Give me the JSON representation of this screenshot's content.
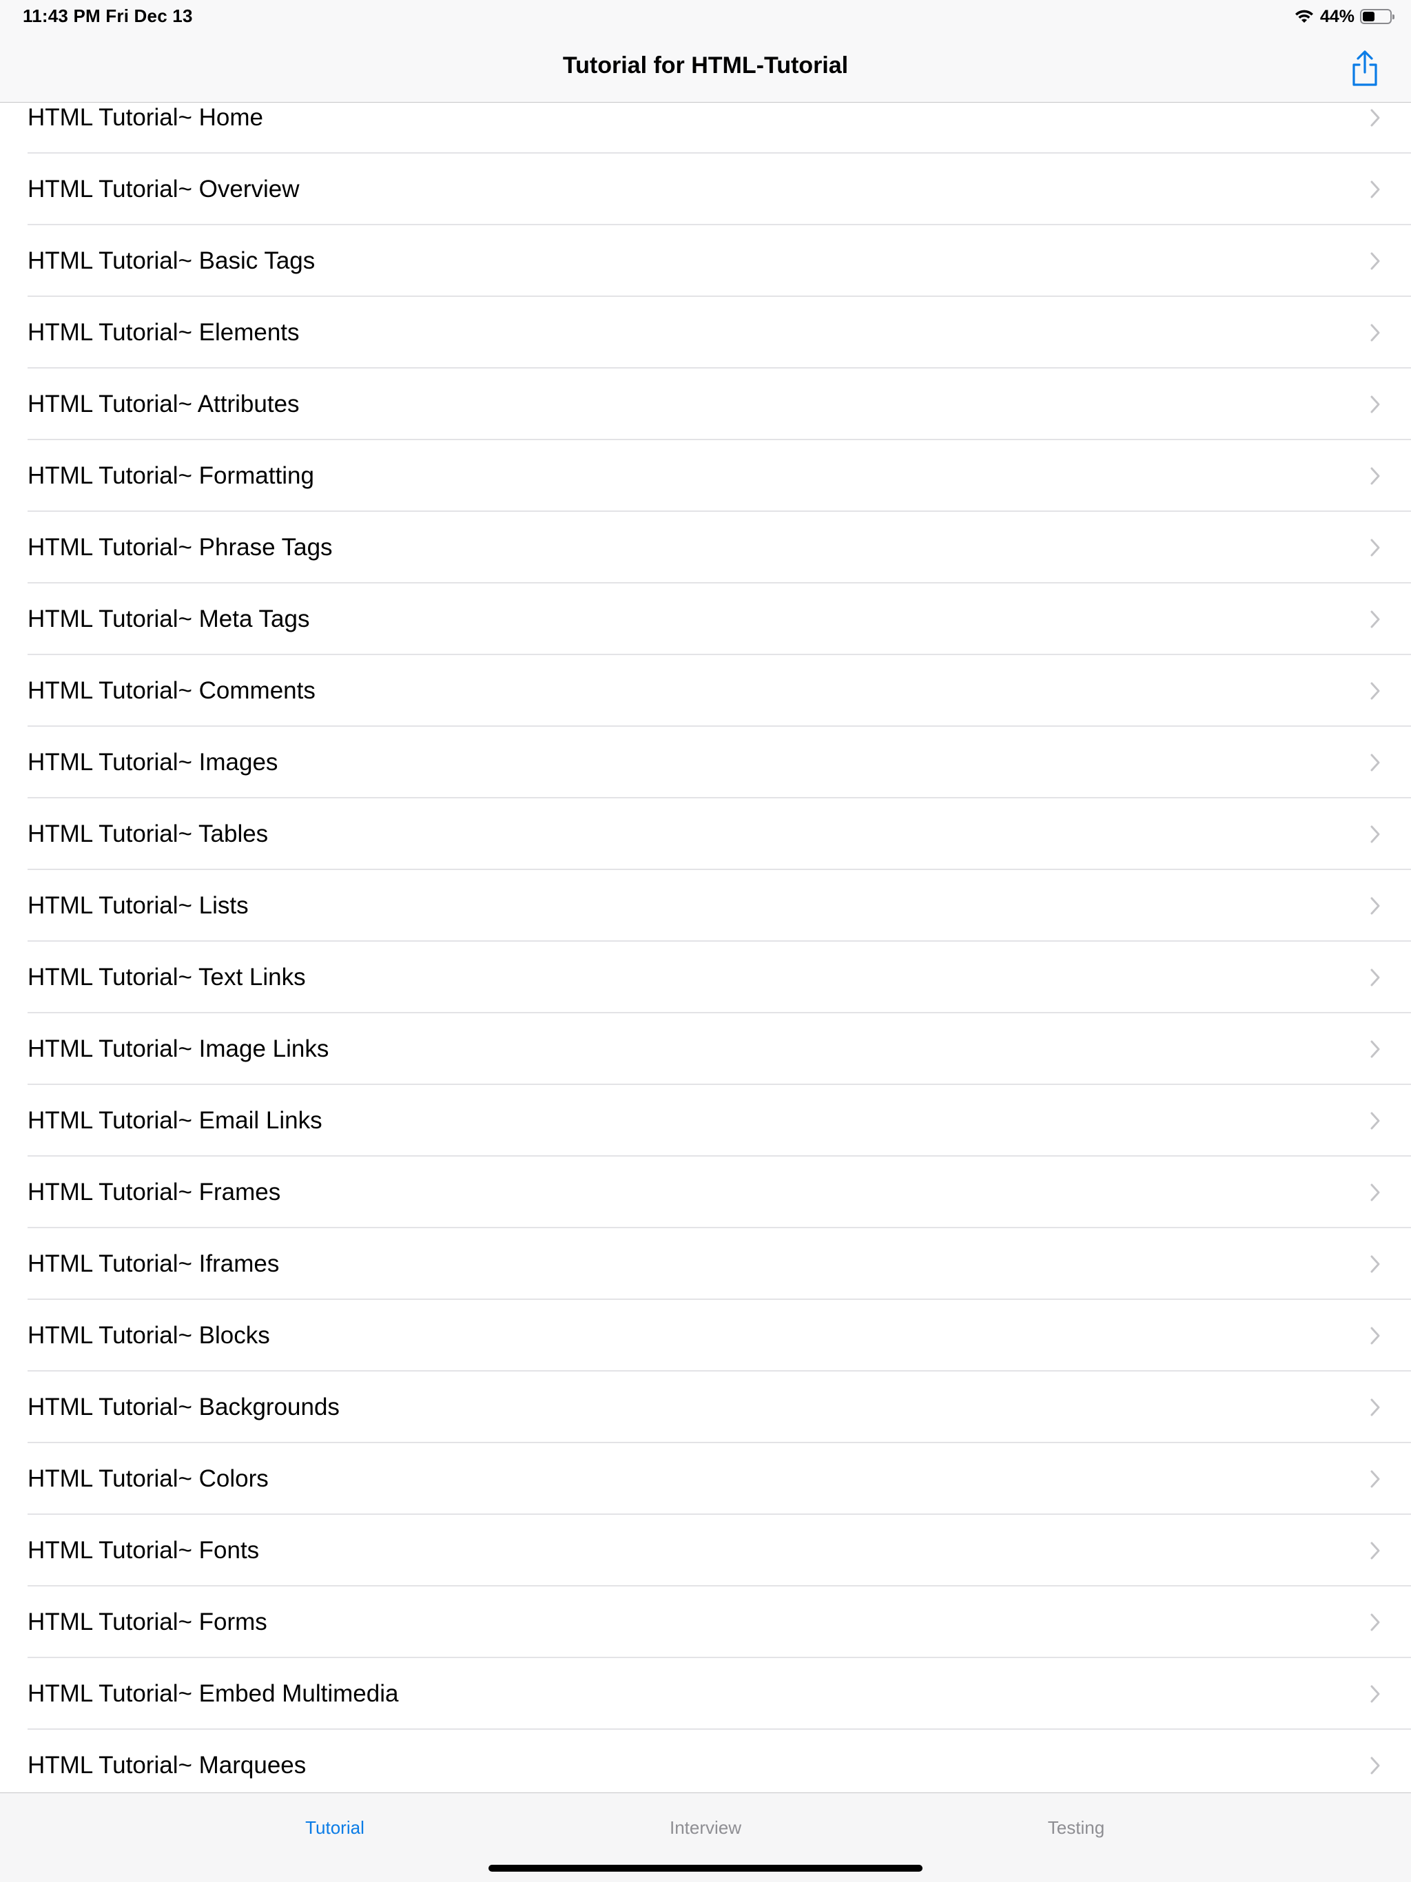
{
  "status_bar": {
    "time": "11:43 PM   Fri Dec 13",
    "battery_percent": "44%",
    "battery_level": 0.44,
    "icons": [
      "wifi-icon",
      "battery-icon"
    ]
  },
  "nav_bar": {
    "title": "Tutorial for HTML-Tutorial",
    "share_icon": "share-icon",
    "accent_color": "#0b7ce6"
  },
  "list": {
    "items": [
      {
        "label": "HTML Tutorial~ Home"
      },
      {
        "label": "HTML Tutorial~ Overview"
      },
      {
        "label": "HTML Tutorial~ Basic Tags"
      },
      {
        "label": "HTML Tutorial~ Elements"
      },
      {
        "label": "HTML Tutorial~ Attributes"
      },
      {
        "label": "HTML Tutorial~ Formatting"
      },
      {
        "label": "HTML Tutorial~ Phrase Tags"
      },
      {
        "label": "HTML Tutorial~ Meta Tags"
      },
      {
        "label": "HTML Tutorial~ Comments"
      },
      {
        "label": "HTML Tutorial~ Images"
      },
      {
        "label": "HTML Tutorial~ Tables"
      },
      {
        "label": "HTML Tutorial~ Lists"
      },
      {
        "label": "HTML Tutorial~ Text Links"
      },
      {
        "label": "HTML Tutorial~ Image Links"
      },
      {
        "label": "HTML Tutorial~ Email Links"
      },
      {
        "label": "HTML Tutorial~ Frames"
      },
      {
        "label": "HTML Tutorial~ Iframes"
      },
      {
        "label": "HTML Tutorial~ Blocks"
      },
      {
        "label": "HTML Tutorial~ Backgrounds"
      },
      {
        "label": "HTML Tutorial~ Colors"
      },
      {
        "label": "HTML Tutorial~ Fonts"
      },
      {
        "label": "HTML Tutorial~ Forms"
      },
      {
        "label": "HTML Tutorial~ Embed Multimedia"
      },
      {
        "label": "HTML Tutorial~ Marquees"
      }
    ],
    "chevron_icon": "chevron-right-icon"
  },
  "tab_bar": {
    "tabs": [
      {
        "label": "Tutorial",
        "active": true
      },
      {
        "label": "Interview",
        "active": false
      },
      {
        "label": "Testing",
        "active": false
      }
    ]
  }
}
